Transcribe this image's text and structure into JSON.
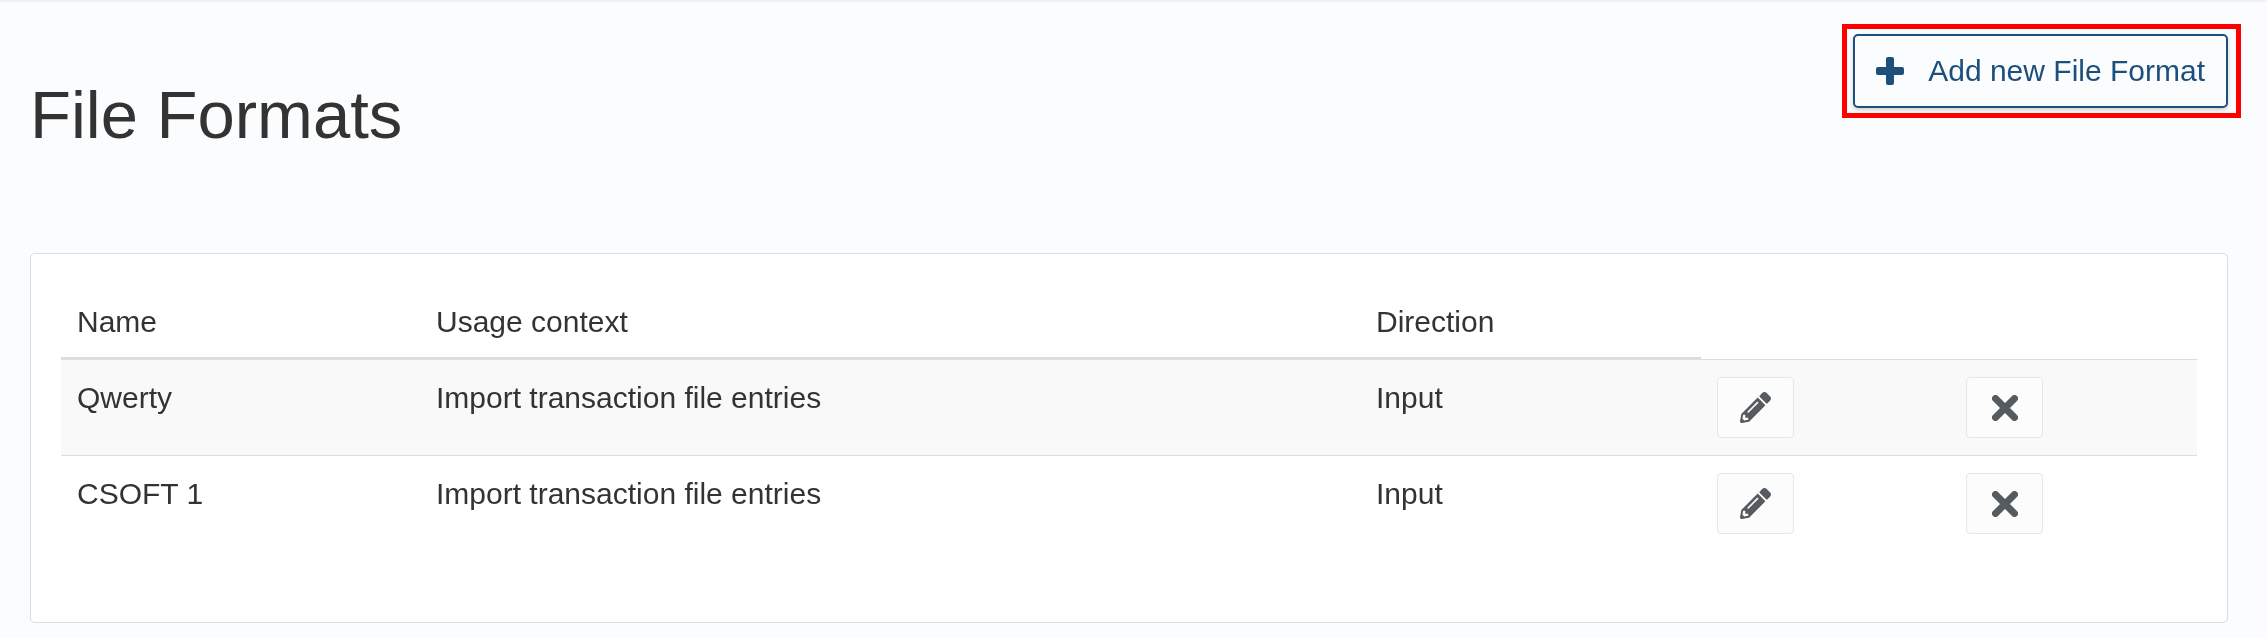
{
  "page": {
    "title": "File Formats"
  },
  "add_button": {
    "label": "Add new File Format",
    "highlighted": true
  },
  "table": {
    "columns": [
      "Name",
      "Usage context",
      "Direction"
    ],
    "rows": [
      {
        "name": "Qwerty",
        "usage_context": "Import transaction file entries",
        "direction": "Input"
      },
      {
        "name": "CSOFT 1",
        "usage_context": "Import transaction file entries",
        "direction": "Input"
      }
    ]
  }
}
